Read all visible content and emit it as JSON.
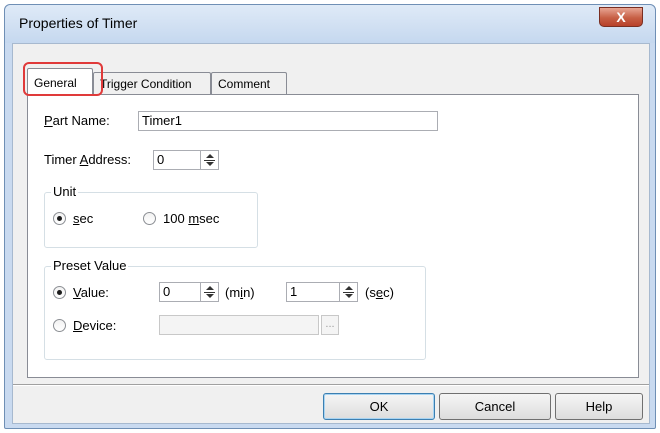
{
  "window": {
    "title": "Properties of Timer",
    "close_glyph": "X"
  },
  "tabs": [
    {
      "label": "General",
      "active": true
    },
    {
      "label": "Trigger Condition",
      "active": false
    },
    {
      "label": "Comment",
      "active": false
    }
  ],
  "general": {
    "part_name": {
      "label_mnemonic": "P",
      "label_rest": "art Name:",
      "value": "Timer1"
    },
    "timer_address": {
      "label_pre": "Timer ",
      "label_mnemonic": "A",
      "label_post": "ddress:",
      "value": "0"
    },
    "unit": {
      "title": "Unit",
      "options": [
        {
          "mnemonic": "s",
          "rest": "ec",
          "checked": true
        },
        {
          "pre": "100 ",
          "mnemonic": "m",
          "rest": "sec",
          "checked": false
        }
      ]
    },
    "preset_value": {
      "title": "Preset Value",
      "value_option": {
        "mnemonic": "V",
        "rest": "alue:",
        "checked": true
      },
      "min_value": "0",
      "min_unit_pre": "(m",
      "min_unit_mnemonic": "i",
      "min_unit_post": "n)",
      "sec_value": "1",
      "sec_unit_pre": "(s",
      "sec_unit_mnemonic": "e",
      "sec_unit_post": "c)",
      "device_option": {
        "mnemonic": "D",
        "rest": "evice:",
        "checked": false
      },
      "device_value": "",
      "browse_label": "..."
    }
  },
  "buttons": {
    "ok": "OK",
    "cancel": "Cancel",
    "help": "Help"
  },
  "colors": {
    "highlight": "#e03a3a",
    "close_button": "#c75f45",
    "frame": "#c9daf0"
  }
}
